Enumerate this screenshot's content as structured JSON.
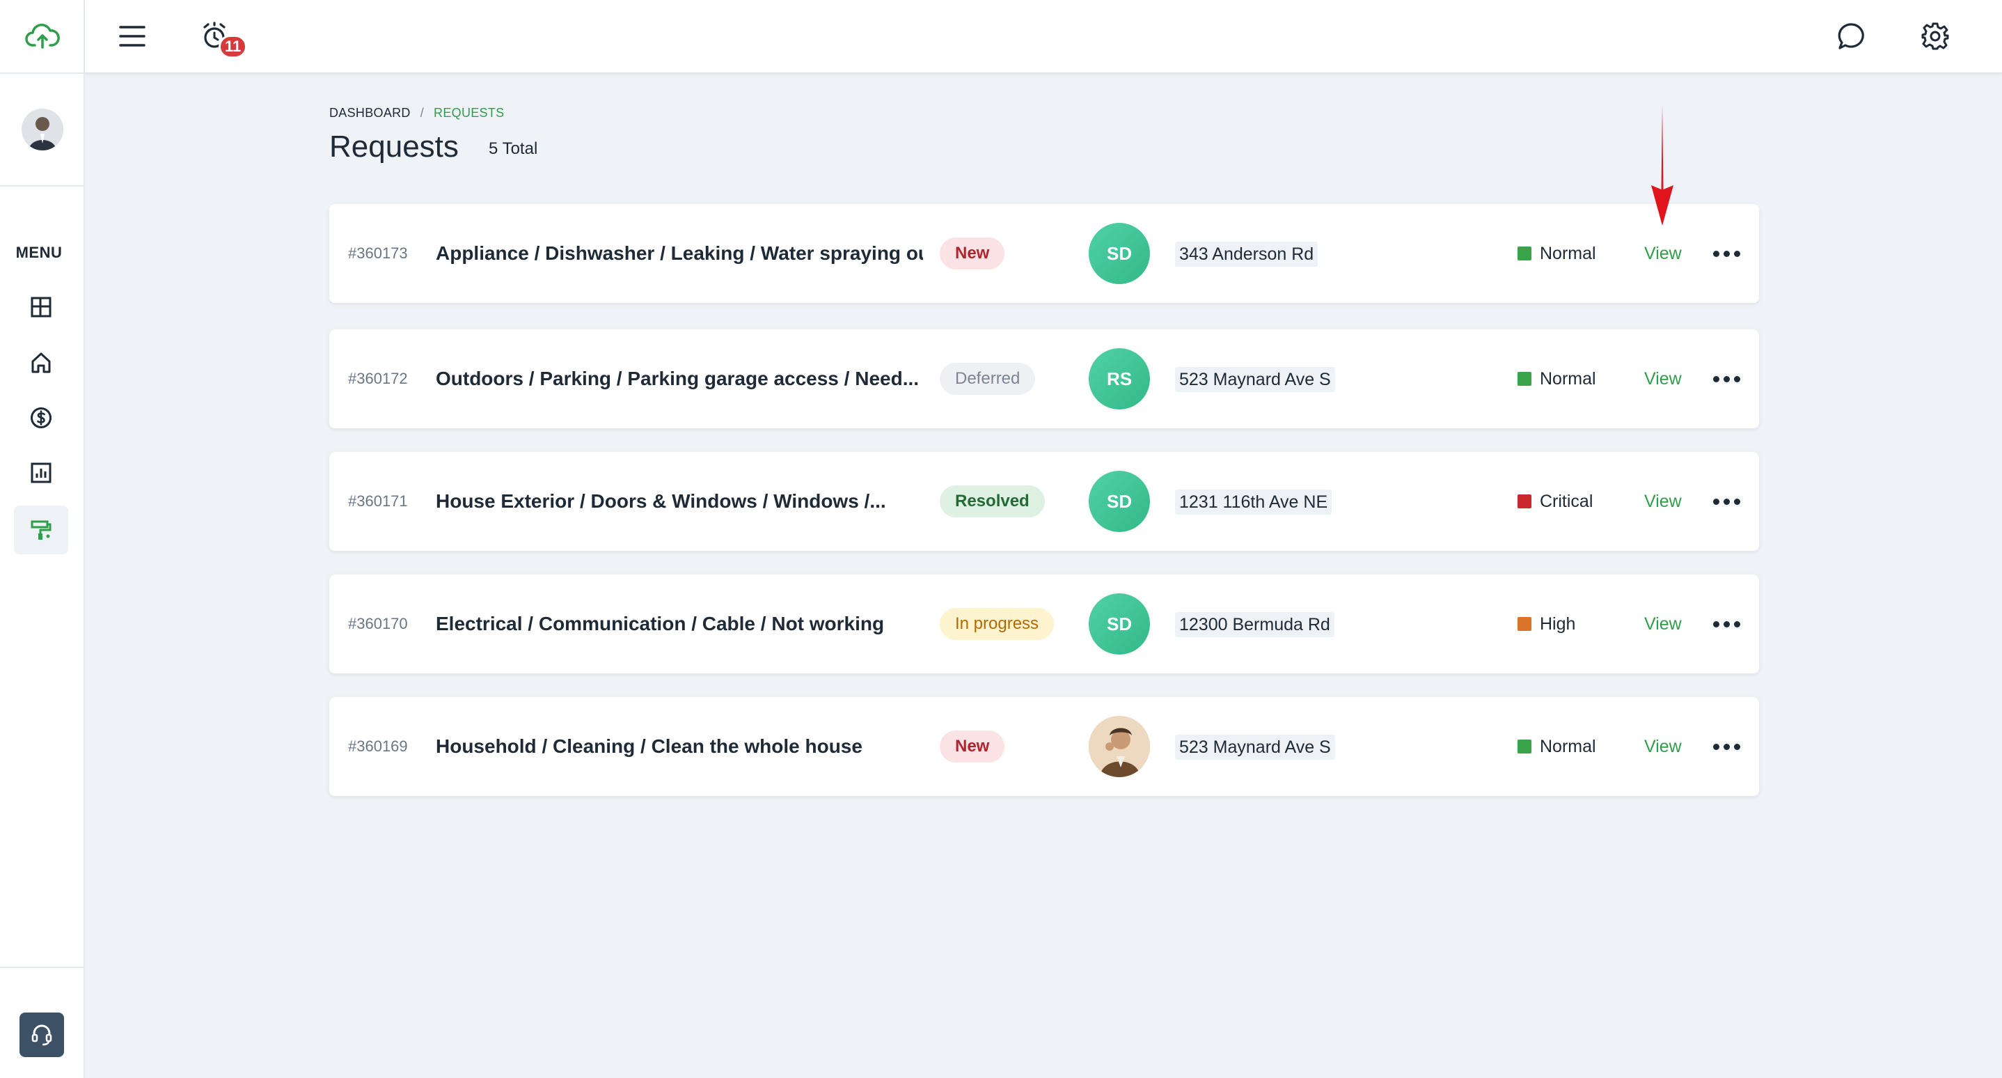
{
  "breadcrumb": {
    "root": "DASHBOARD",
    "separator": "/",
    "current": "REQUESTS"
  },
  "page": {
    "title": "Requests",
    "total": "5 Total"
  },
  "sidebar": {
    "menu_label": "MENU"
  },
  "topbar": {
    "notification_count": "11"
  },
  "colors": {
    "accent": "#2e9e4a",
    "normal": "#3aa34a",
    "critical": "#c9282d",
    "high": "#d9742b"
  },
  "requests": [
    {
      "id": "#360173",
      "title": "Appliance / Dishwasher / Leaking / Water spraying out",
      "status": "New",
      "assignee": "SD",
      "address": "343 Anderson Rd",
      "priority": "Normal",
      "view": "View"
    },
    {
      "id": "#360172",
      "title": "Outdoors / Parking / Parking garage access / Need...",
      "status": "Deferred",
      "assignee": "RS",
      "address": "523 Maynard Ave S",
      "priority": "Normal",
      "view": "View"
    },
    {
      "id": "#360171",
      "title": "House Exterior / Doors & Windows / Windows /...",
      "status": "Resolved",
      "assignee": "SD",
      "address": "1231 116th Ave NE",
      "priority": "Critical",
      "view": "View"
    },
    {
      "id": "#360170",
      "title": "Electrical / Communication / Cable / Not working",
      "status": "In progress",
      "assignee": "SD",
      "address": "12300 Bermuda Rd",
      "priority": "High",
      "view": "View"
    },
    {
      "id": "#360169",
      "title": "Household / Cleaning / Clean the whole house",
      "status": "New",
      "assignee": "",
      "address": "523 Maynard Ave S",
      "priority": "Normal",
      "view": "View"
    }
  ]
}
